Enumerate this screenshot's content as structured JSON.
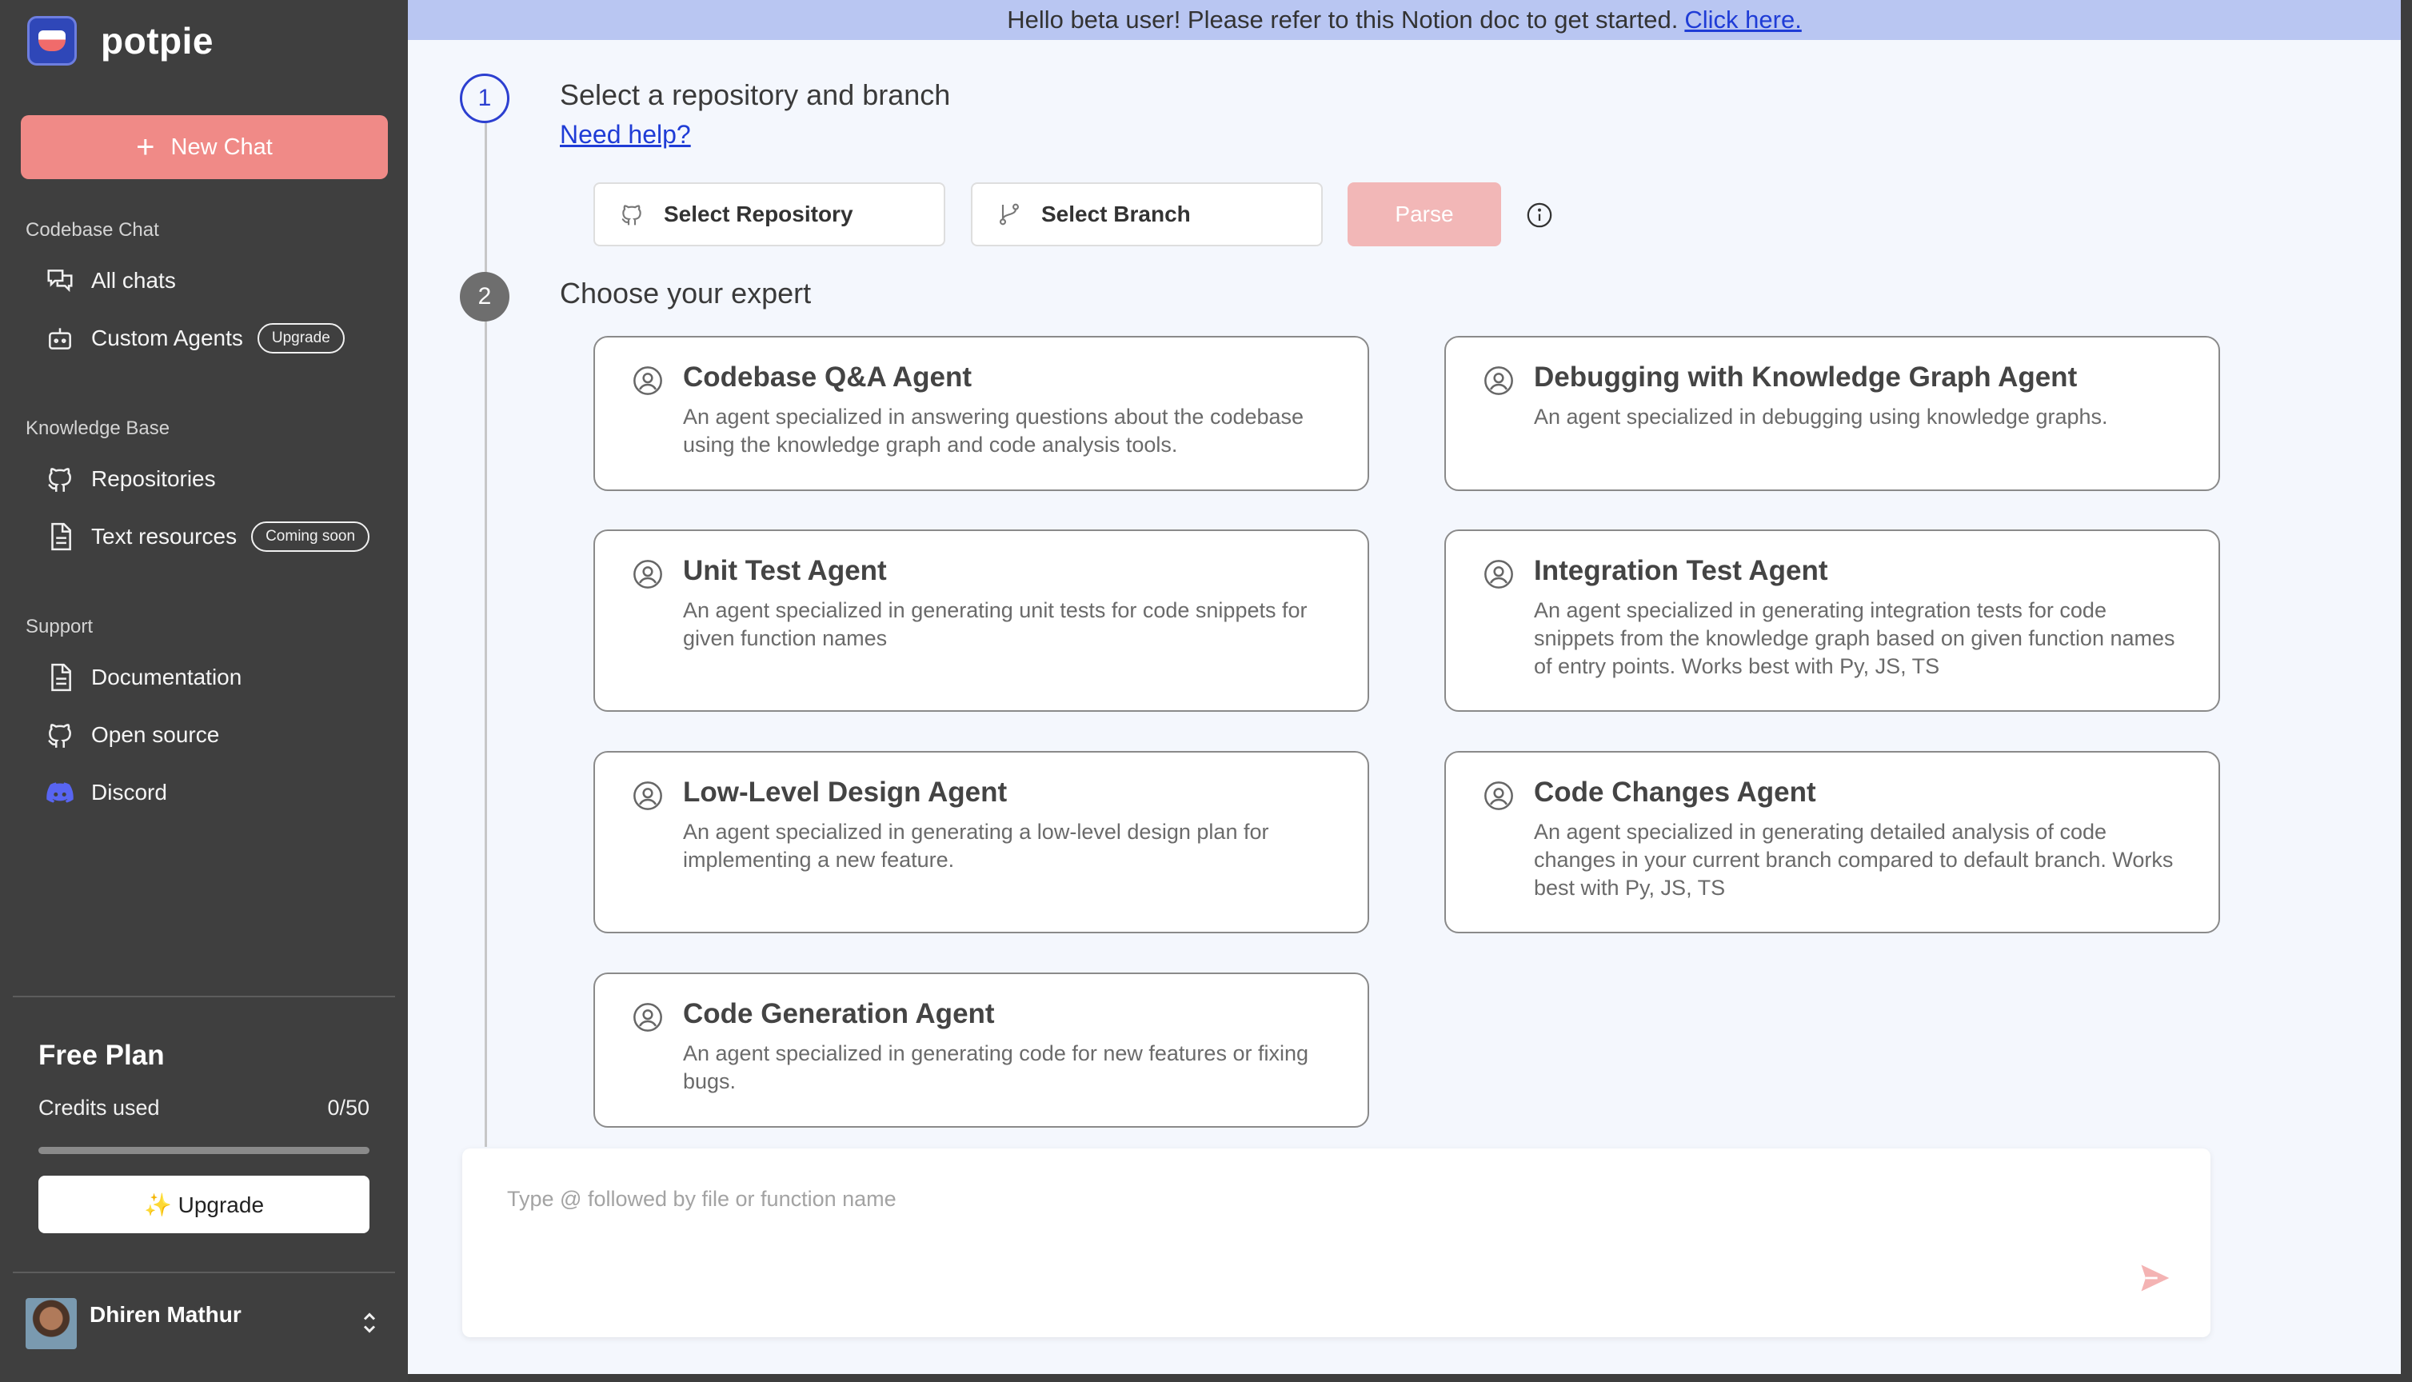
{
  "brand": {
    "name": "potpie"
  },
  "sidebar": {
    "new_chat_label": "New Chat",
    "sections": [
      {
        "label": "Codebase Chat"
      },
      {
        "label": "Knowledge Base"
      },
      {
        "label": "Support"
      }
    ],
    "items": {
      "all_chats": "All chats",
      "custom_agents": "Custom Agents",
      "custom_agents_badge": "Upgrade",
      "repositories": "Repositories",
      "text_resources": "Text resources",
      "text_resources_badge": "Coming soon",
      "documentation": "Documentation",
      "open_source": "Open source",
      "discord": "Discord"
    },
    "plan": {
      "title": "Free Plan",
      "credits_label": "Credits used",
      "credits_value": "0/50",
      "credits_fraction": 0,
      "upgrade_label": "✨ Upgrade"
    },
    "user": {
      "name": "Dhiren Mathur"
    }
  },
  "banner": {
    "text": "Hello beta user! Please refer to this Notion doc to get started.",
    "link": "Click here."
  },
  "step1": {
    "number": "1",
    "title": "Select a repository and branch",
    "help": "Need help?",
    "repo_label": "Select Repository",
    "branch_label": "Select Branch",
    "parse_label": "Parse"
  },
  "step2": {
    "number": "2",
    "title": "Choose your expert"
  },
  "agents": [
    {
      "title": "Codebase Q&A Agent",
      "desc": "An agent specialized in answering questions about the codebase using the knowledge graph and code analysis tools."
    },
    {
      "title": "Debugging with Knowledge Graph Agent",
      "desc": "An agent specialized in debugging using knowledge graphs."
    },
    {
      "title": "Unit Test Agent",
      "desc": "An agent specialized in generating unit tests for code snippets for given function names"
    },
    {
      "title": "Integration Test Agent",
      "desc": "An agent specialized in generating integration tests for code snippets from the knowledge graph based on given function names of entry points. Works best with Py, JS, TS"
    },
    {
      "title": "Low-Level Design Agent",
      "desc": "An agent specialized in generating a low-level design plan for implementing a new feature."
    },
    {
      "title": "Code Changes Agent",
      "desc": "An agent specialized in generating detailed analysis of code changes in your current branch compared to default branch. Works best with Py, JS, TS"
    },
    {
      "title": "Code Generation Agent",
      "desc": "An agent specialized in generating code for new features or fixing bugs."
    }
  ],
  "composer": {
    "placeholder": "Type @ followed by file or function name",
    "value": ""
  },
  "colors": {
    "accent": "#f08a87",
    "link": "#1f3cd6",
    "banner_bg": "#b9c6f2",
    "sidebar_bg": "#3f3f3f"
  }
}
